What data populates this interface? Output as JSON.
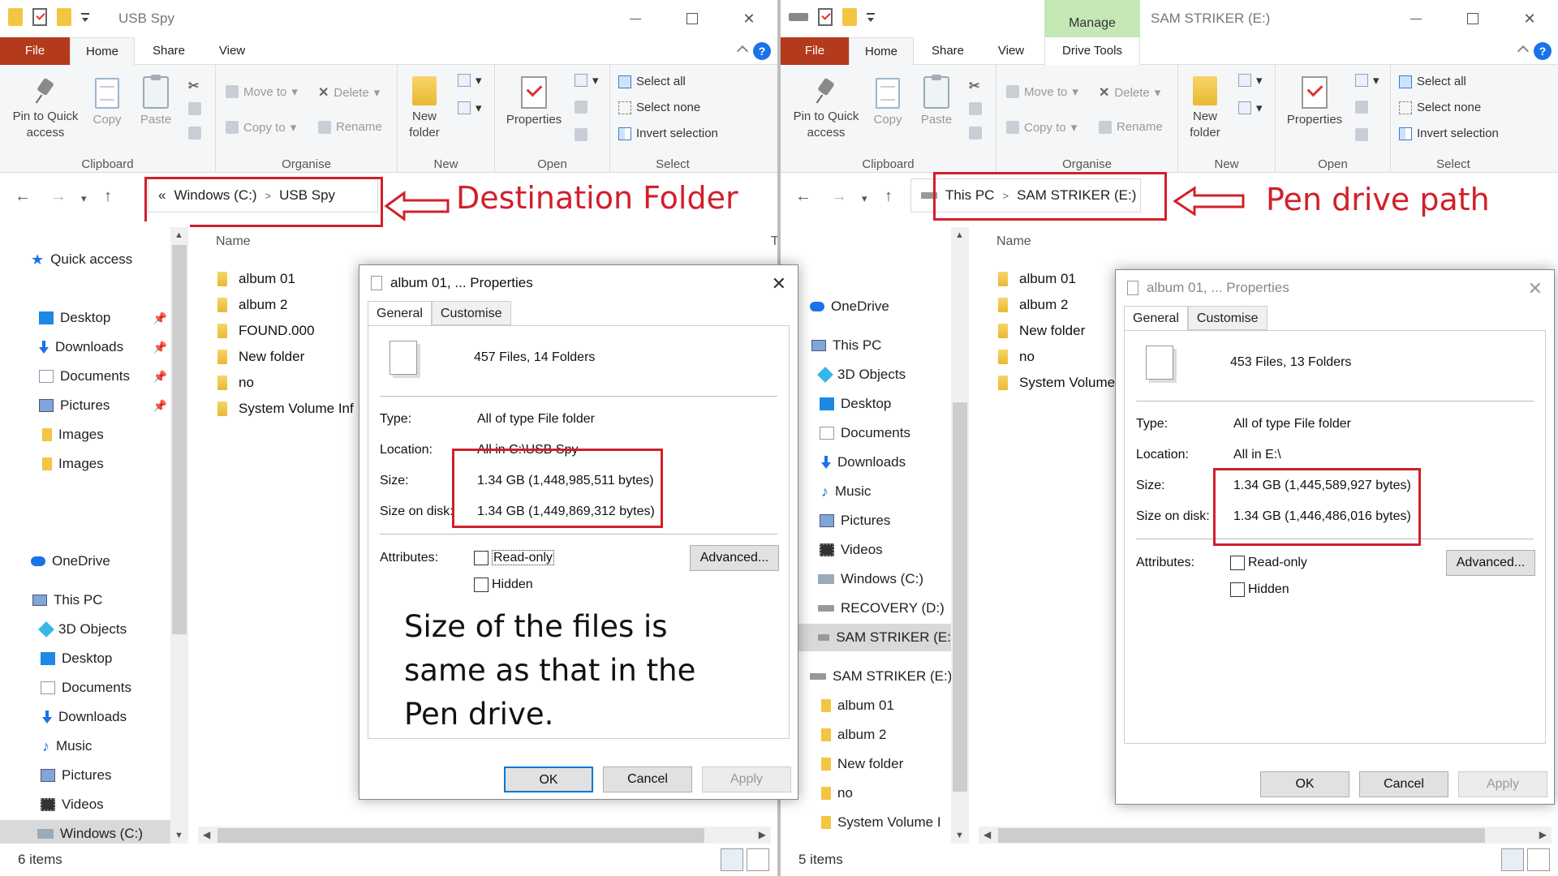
{
  "left": {
    "title": "USB Spy",
    "tabs": {
      "file": "File",
      "home": "Home",
      "share": "Share",
      "view": "View"
    },
    "help": "?",
    "ribbon": {
      "pin": "Pin to Quick access",
      "copy": "Copy",
      "paste": "Paste",
      "clipboard": "Clipboard",
      "move_to": "Move to",
      "copy_to": "Copy to",
      "delete": "Delete",
      "rename": "Rename",
      "organise": "Organise",
      "new_folder": "New folder",
      "new": "New",
      "properties": "Properties",
      "open": "Open",
      "select_all": "Select all",
      "select_none": "Select none",
      "invert": "Invert selection",
      "select": "Select"
    },
    "address": {
      "chev": "«",
      "seg1": "Windows (C:)",
      "sep": ">",
      "seg2": "USB Spy"
    },
    "annotation": "Destination Folder",
    "nav": {
      "quick_access": "Quick access",
      "desktop": "Desktop",
      "downloads": "Downloads",
      "documents": "Documents",
      "pictures": "Pictures",
      "images1": "Images",
      "images2": "Images",
      "onedrive": "OneDrive",
      "thispc": "This PC",
      "objects3d": "3D Objects",
      "desktop2": "Desktop",
      "documents2": "Documents",
      "downloads2": "Downloads",
      "music": "Music",
      "pictures2": "Pictures",
      "videos": "Videos",
      "windows_c": "Windows (C:)"
    },
    "col_name": "Name",
    "col_t": "T",
    "files": [
      "album 01",
      "album 2",
      "FOUND.000",
      "New folder",
      "no",
      "System Volume Inf"
    ],
    "status": "6 items"
  },
  "right": {
    "title": "SAM STRIKER (E:)",
    "manage": "Manage",
    "tabs": {
      "file": "File",
      "home": "Home",
      "share": "Share",
      "view": "View",
      "drive": "Drive Tools"
    },
    "help": "?",
    "ribbon": {
      "pin": "Pin to Quick access",
      "copy": "Copy",
      "paste": "Paste",
      "clipboard": "Clipboard",
      "move_to": "Move to",
      "copy_to": "Copy to",
      "delete": "Delete",
      "rename": "Rename",
      "organise": "Organise",
      "new_folder": "New folder",
      "new": "New",
      "properties": "Properties",
      "open": "Open",
      "select_all": "Select all",
      "select_none": "Select none",
      "invert": "Invert selection",
      "select": "Select"
    },
    "address": {
      "seg1": "This PC",
      "sep": ">",
      "seg2": "SAM STRIKER (E:)"
    },
    "annotation": "Pen drive path",
    "nav": {
      "onedrive": "OneDrive",
      "thispc": "This PC",
      "objects3d": "3D Objects",
      "desktop": "Desktop",
      "documents": "Documents",
      "downloads": "Downloads",
      "music": "Music",
      "pictures": "Pictures",
      "videos": "Videos",
      "windows_c": "Windows (C:)",
      "recovery": "RECOVERY (D:)",
      "sam_sel": "SAM STRIKER (E:",
      "sam": "SAM STRIKER (E:)",
      "album01": "album 01",
      "album2": "album 2",
      "newfolder": "New folder",
      "no": "no",
      "sysvol": "System Volume I"
    },
    "col_name": "Name",
    "files": [
      "album 01",
      "album 2",
      "New folder",
      "no",
      "System Volume"
    ],
    "status": "5 items"
  },
  "dialog_left": {
    "title": "album 01, ... Properties",
    "tab_general": "General",
    "tab_customise": "Customise",
    "count": "457 Files, 14 Folders",
    "type_label": "Type:",
    "type_value": "All of type File folder",
    "location_label": "Location:",
    "location_value": "All in C:\\USB Spy",
    "size_label": "Size:",
    "size_value": "1.34 GB (1,448,985,511 bytes)",
    "disk_label": "Size on disk:",
    "disk_value": "1.34 GB (1,449,869,312 bytes)",
    "attributes_label": "Attributes:",
    "readonly": "Read-only",
    "hidden": "Hidden",
    "advanced": "Advanced...",
    "note": "Size of the files is same as that in the Pen drive.",
    "ok": "OK",
    "cancel": "Cancel",
    "apply": "Apply"
  },
  "dialog_right": {
    "title": "album 01, ... Properties",
    "tab_general": "General",
    "tab_customise": "Customise",
    "count": "453 Files, 13 Folders",
    "type_label": "Type:",
    "type_value": "All of type File folder",
    "location_label": "Location:",
    "location_value": "All in E:\\",
    "size_label": "Size:",
    "size_value": "1.34 GB (1,445,589,927 bytes)",
    "disk_label": "Size on disk:",
    "disk_value": "1.34 GB (1,446,486,016 bytes)",
    "attributes_label": "Attributes:",
    "readonly": "Read-only",
    "hidden": "Hidden",
    "advanced": "Advanced...",
    "ok": "OK",
    "cancel": "Cancel",
    "apply": "Apply"
  },
  "colors": {
    "file_tab": "#b33a1c",
    "annotation": "#d1202b",
    "manage_tab": "#c6e8b6",
    "help": "#1a73e8"
  }
}
